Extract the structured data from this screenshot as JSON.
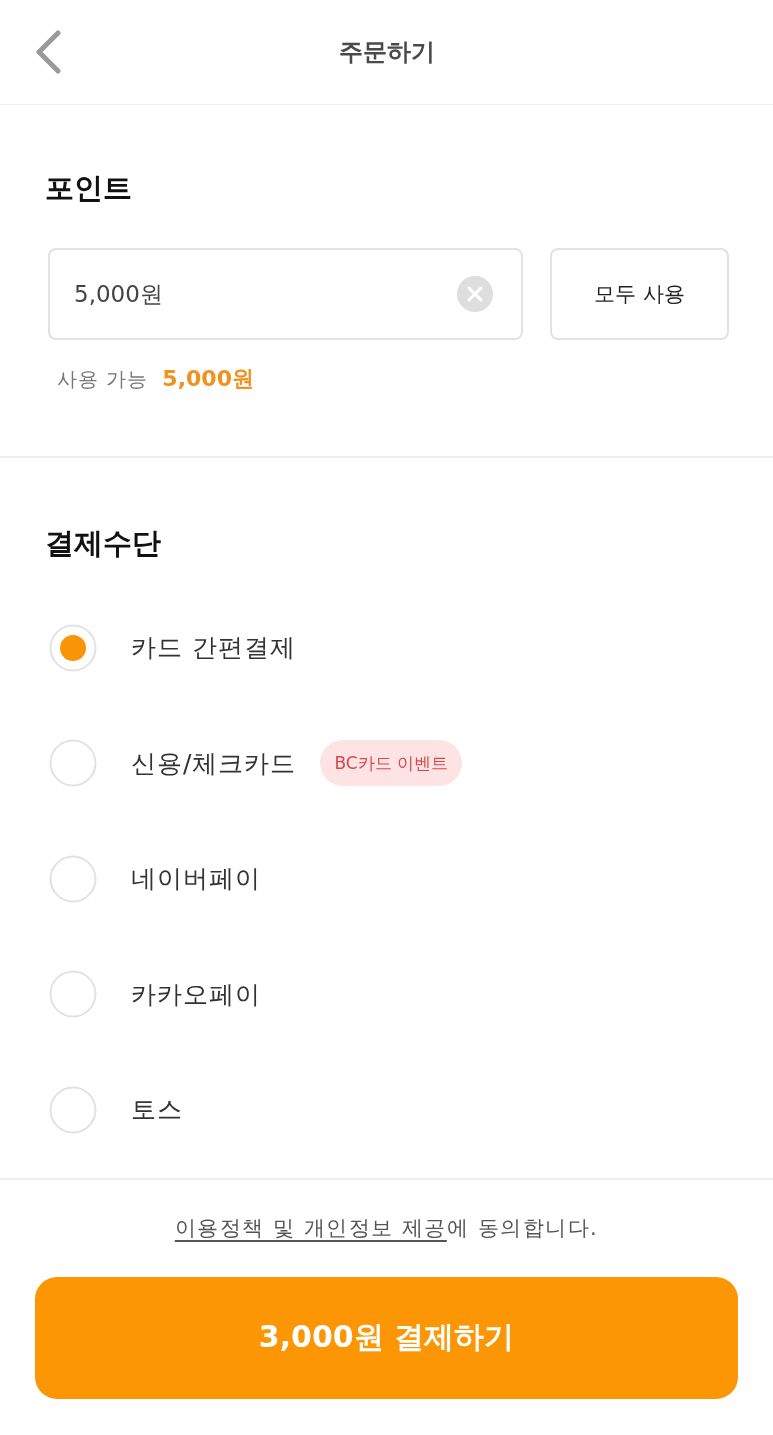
{
  "header": {
    "title": "주문하기"
  },
  "points": {
    "title": "포인트",
    "input": {
      "value": "5,000원"
    },
    "use_all_button": "모두 사용",
    "available_label": "사용 가능",
    "available_amount": "5,000원"
  },
  "payment": {
    "title": "결제수단",
    "methods": [
      {
        "label": "카드 간편결제",
        "selected": true
      },
      {
        "label": "신용/체크카드",
        "selected": false,
        "badge": "BC카드 이벤트"
      },
      {
        "label": "네이버페이",
        "selected": false
      },
      {
        "label": "카카오페이",
        "selected": false
      },
      {
        "label": "토스",
        "selected": false
      }
    ]
  },
  "agreement": {
    "link": "이용정책 및 개인정보 제공",
    "text": "에 동의합니다."
  },
  "pay_button": {
    "label": "3,000원 결제하기"
  }
}
